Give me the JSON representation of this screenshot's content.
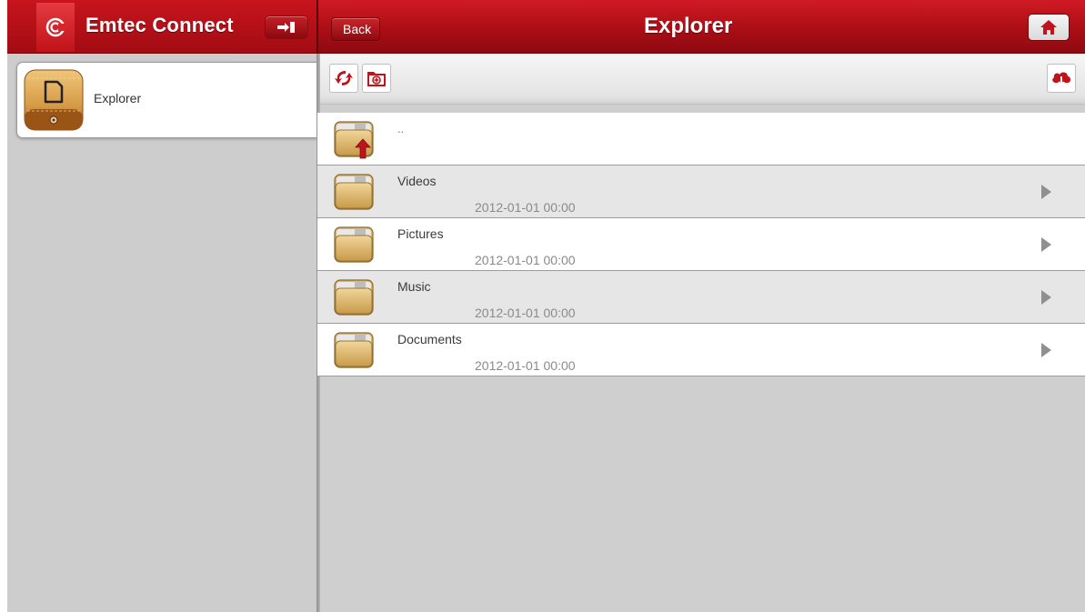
{
  "app": {
    "title": "Emtec Connect",
    "logo_icon": "emtec-logo-icon",
    "exit_icon": "exit-icon"
  },
  "header": {
    "back_label": "Back",
    "title": "Explorer",
    "home_icon": "home-icon"
  },
  "sidebar": {
    "items": [
      {
        "label": "Explorer",
        "icon": "explorer-app-icon"
      }
    ]
  },
  "toolbar": {
    "left": [
      "refresh-icon",
      "new-folder-icon"
    ],
    "right": [
      "cloud-upload-icon"
    ]
  },
  "list": {
    "parent": {
      "label": ".."
    },
    "folders": [
      {
        "name": "Videos",
        "date": "2012-01-01 00:00"
      },
      {
        "name": "Pictures",
        "date": "2012-01-01 00:00"
      },
      {
        "name": "Music",
        "date": "2012-01-01 00:00"
      },
      {
        "name": "Documents",
        "date": "2012-01-01 00:00"
      }
    ]
  },
  "colors": {
    "brand_red": "#b5111a",
    "sidebar_bg": "#cdcdcd",
    "row_alt": "#e6e6e6"
  }
}
